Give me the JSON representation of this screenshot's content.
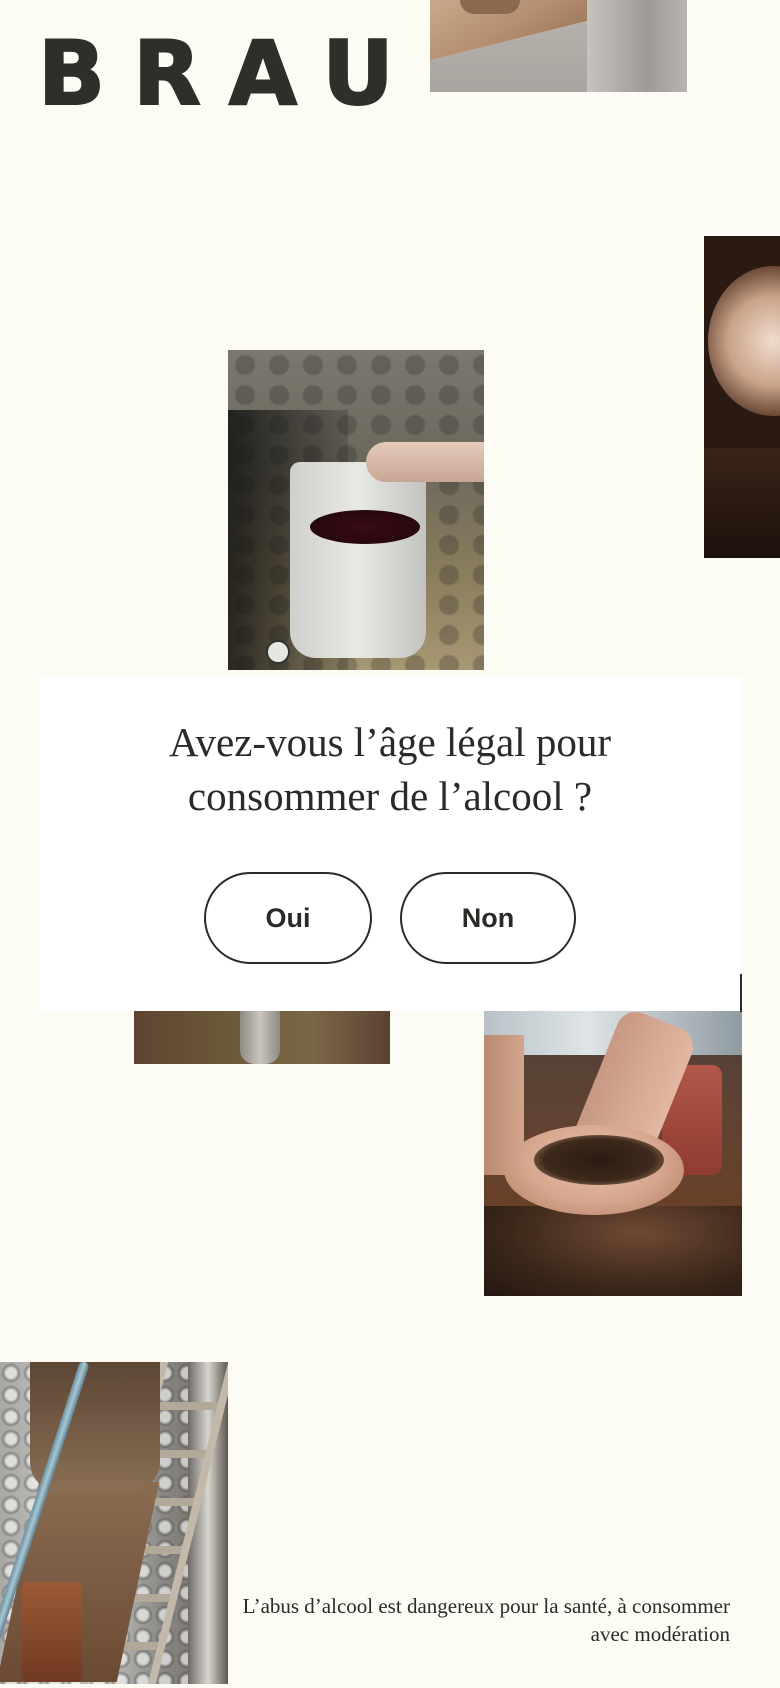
{
  "brand": {
    "logo_text": "BRAU"
  },
  "age_gate": {
    "title_line1": "Avez-vous l’âge légal pour",
    "title_line2": "consommer de l’alcool ?",
    "yes_label": "Oui",
    "no_label": "Non"
  },
  "footer": {
    "disclaimer_line1": "L’abus d’alcool est dangereux pour la santé, à consommer",
    "disclaimer_line2": "avec modération"
  },
  "colors": {
    "background": "#fcfbf4",
    "text": "#2c2a27",
    "modal": "#ffffff"
  }
}
